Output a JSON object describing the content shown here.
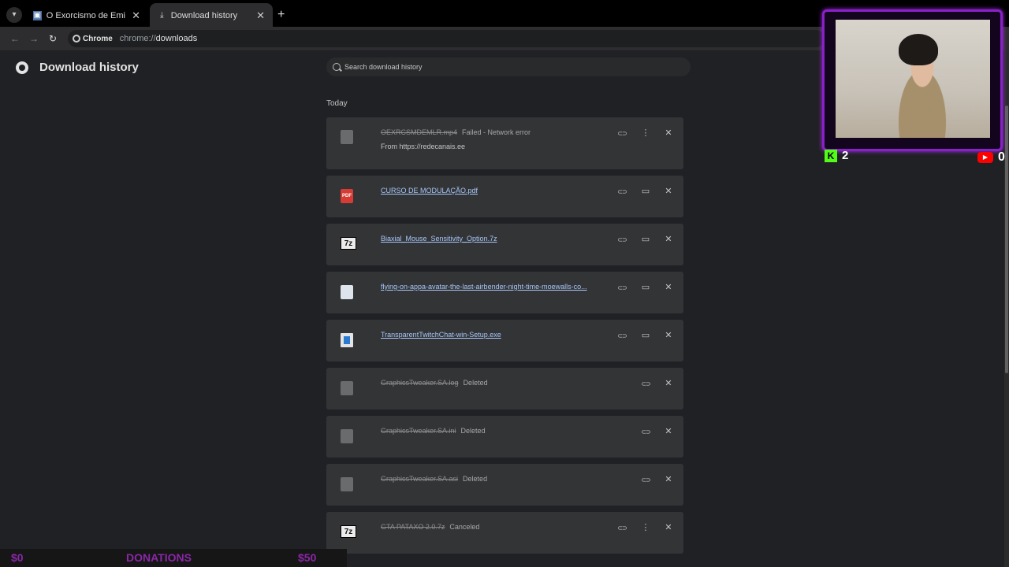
{
  "tabs": [
    {
      "title": "O Exorcismo de Emily Rose (Du",
      "icon": "site-icon"
    },
    {
      "title": "Download history",
      "icon": "download-icon"
    }
  ],
  "omnibox": {
    "chip": "Chrome",
    "scheme": "chrome://",
    "path": "downloads"
  },
  "page": {
    "title": "Download history",
    "search_placeholder": "Search download history",
    "section": "Today"
  },
  "downloads": [
    {
      "name": "OEXRCSMDEMLR.mp4",
      "status": "Failed - Network error",
      "sub": "From https://redecanais.ee",
      "icon": "doc",
      "style": "strike"
    },
    {
      "name": "CURSO DE MODULAÇÃO.pdf",
      "status": "",
      "sub": "",
      "icon": "pdf",
      "style": "link"
    },
    {
      "name": "Biaxial_Mouse_Sensitivity_Option.7z",
      "status": "",
      "sub": "",
      "icon": "7z",
      "style": "link"
    },
    {
      "name": "flying-on-appa-avatar-the-last-airbender-night-time-moewalls-co...",
      "status": "",
      "sub": "",
      "icon": "img",
      "style": "link"
    },
    {
      "name": "TransparentTwitchChat-win-Setup.exe",
      "status": "",
      "sub": "",
      "icon": "exe",
      "style": "link"
    },
    {
      "name": "GraphicsTweaker.SA.log",
      "status": "Deleted",
      "sub": "",
      "icon": "doc",
      "style": "strike"
    },
    {
      "name": "GraphicsTweaker.SA.ini",
      "status": "Deleted",
      "sub": "",
      "icon": "doc",
      "style": "strike"
    },
    {
      "name": "GraphicsTweaker.SA.asi",
      "status": "Deleted",
      "sub": "",
      "icon": "doc",
      "style": "strike"
    },
    {
      "name": "GTA PATAXO 2.0.7z",
      "status": "Canceled",
      "sub": "",
      "icon": "7z",
      "style": "strike"
    }
  ],
  "overlay": {
    "kick_count": "2",
    "youtube_count": "0",
    "bar_left": "$0",
    "bar_mid": "DONATIONS",
    "bar_right": "$50"
  }
}
